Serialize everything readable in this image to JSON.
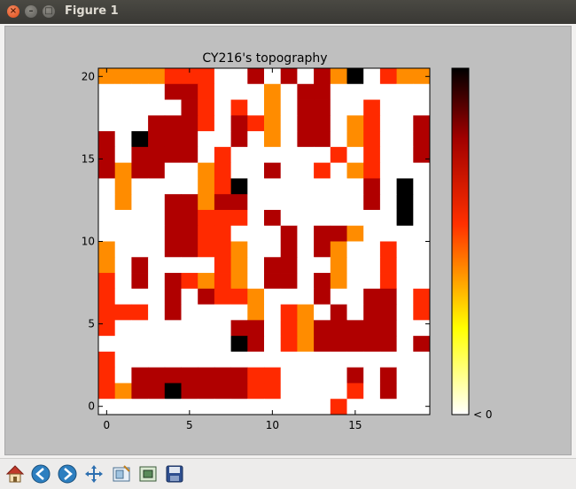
{
  "window": {
    "title": "Figure 1"
  },
  "toolbar": {
    "buttons": [
      "home-icon",
      "back-arrow-icon",
      "forward-arrow-icon",
      "pan-icon",
      "subplots-icon",
      "zoom-rect-icon",
      "save-icon"
    ]
  },
  "colors": {
    "figure_background": "#bfbfbf",
    "cmap": [
      "#ffffff",
      "#ffff00",
      "#ff8c00",
      "#ff2a00",
      "#b00000",
      "#000000"
    ]
  },
  "chart_data": {
    "type": "heatmap",
    "title": "CY216's topography",
    "xlabel": "",
    "ylabel": "",
    "x_ticks": [
      0,
      5,
      10,
      15
    ],
    "y_ticks": [
      0,
      5,
      10,
      15,
      20
    ],
    "xlim": [
      -0.5,
      19.5
    ],
    "ylim": [
      -0.5,
      20.5
    ],
    "colorbar": {
      "label": "< 0",
      "colormap": "hot_r",
      "range": [
        0,
        1
      ]
    },
    "grid": false,
    "rows_from_y20_to_y0": [
      [
        2,
        2,
        2,
        2,
        3,
        3,
        3,
        0,
        0,
        4,
        0,
        4,
        0,
        4,
        2,
        5,
        0,
        3,
        2,
        2
      ],
      [
        0,
        0,
        0,
        0,
        4,
        4,
        3,
        0,
        0,
        0,
        2,
        0,
        4,
        4,
        0,
        0,
        0,
        0,
        0,
        0
      ],
      [
        0,
        0,
        0,
        0,
        0,
        4,
        3,
        0,
        3,
        0,
        2,
        0,
        4,
        4,
        0,
        0,
        3,
        0,
        0,
        0
      ],
      [
        0,
        0,
        0,
        4,
        4,
        4,
        3,
        0,
        4,
        3,
        2,
        0,
        4,
        4,
        0,
        2,
        3,
        0,
        0,
        4
      ],
      [
        4,
        0,
        5,
        4,
        4,
        4,
        0,
        0,
        4,
        0,
        2,
        0,
        4,
        4,
        0,
        2,
        3,
        0,
        0,
        4
      ],
      [
        4,
        0,
        4,
        4,
        4,
        4,
        0,
        3,
        0,
        0,
        0,
        0,
        0,
        0,
        3,
        0,
        3,
        0,
        0,
        4
      ],
      [
        4,
        2,
        4,
        4,
        0,
        0,
        2,
        3,
        0,
        0,
        4,
        0,
        0,
        3,
        0,
        2,
        3,
        0,
        0,
        0
      ],
      [
        0,
        2,
        0,
        0,
        0,
        0,
        2,
        3,
        5,
        0,
        0,
        0,
        0,
        0,
        0,
        0,
        4,
        0,
        5,
        0
      ],
      [
        0,
        2,
        0,
        0,
        4,
        4,
        2,
        4,
        4,
        0,
        0,
        0,
        0,
        0,
        0,
        0,
        4,
        0,
        5,
        0
      ],
      [
        0,
        0,
        0,
        0,
        4,
        4,
        3,
        3,
        3,
        0,
        4,
        0,
        0,
        0,
        0,
        0,
        0,
        0,
        5,
        0
      ],
      [
        0,
        0,
        0,
        0,
        4,
        4,
        3,
        3,
        0,
        0,
        0,
        4,
        0,
        4,
        4,
        2,
        0,
        0,
        0,
        0
      ],
      [
        2,
        0,
        0,
        0,
        4,
        4,
        3,
        3,
        2,
        0,
        0,
        4,
        0,
        4,
        2,
        0,
        0,
        3,
        0,
        0
      ],
      [
        2,
        0,
        4,
        0,
        0,
        0,
        0,
        3,
        2,
        0,
        4,
        4,
        0,
        0,
        2,
        0,
        0,
        3,
        0,
        0
      ],
      [
        3,
        0,
        4,
        0,
        4,
        3,
        2,
        3,
        2,
        0,
        4,
        4,
        0,
        4,
        2,
        0,
        0,
        3,
        0,
        0
      ],
      [
        3,
        0,
        0,
        0,
        4,
        0,
        4,
        3,
        3,
        2,
        0,
        0,
        0,
        4,
        0,
        0,
        4,
        4,
        0,
        3
      ],
      [
        3,
        3,
        3,
        0,
        4,
        0,
        0,
        0,
        0,
        2,
        0,
        3,
        2,
        0,
        4,
        0,
        4,
        4,
        0,
        3
      ],
      [
        3,
        0,
        0,
        0,
        0,
        0,
        0,
        0,
        4,
        4,
        0,
        3,
        2,
        4,
        4,
        4,
        4,
        4,
        0,
        0
      ],
      [
        0,
        0,
        0,
        0,
        0,
        0,
        0,
        0,
        5,
        4,
        0,
        3,
        2,
        4,
        4,
        4,
        4,
        4,
        0,
        4
      ],
      [
        3,
        0,
        0,
        0,
        0,
        0,
        0,
        0,
        0,
        0,
        0,
        0,
        0,
        0,
        0,
        0,
        0,
        0,
        0,
        0
      ],
      [
        3,
        0,
        4,
        4,
        4,
        4,
        4,
        4,
        4,
        3,
        3,
        0,
        0,
        0,
        0,
        4,
        0,
        4,
        0,
        0
      ],
      [
        3,
        2,
        4,
        4,
        5,
        4,
        4,
        4,
        4,
        3,
        3,
        0,
        0,
        0,
        0,
        3,
        0,
        4,
        0,
        0
      ],
      [
        0,
        0,
        0,
        0,
        0,
        0,
        0,
        0,
        0,
        0,
        0,
        0,
        0,
        0,
        3,
        0,
        0,
        0,
        0,
        0
      ]
    ]
  }
}
